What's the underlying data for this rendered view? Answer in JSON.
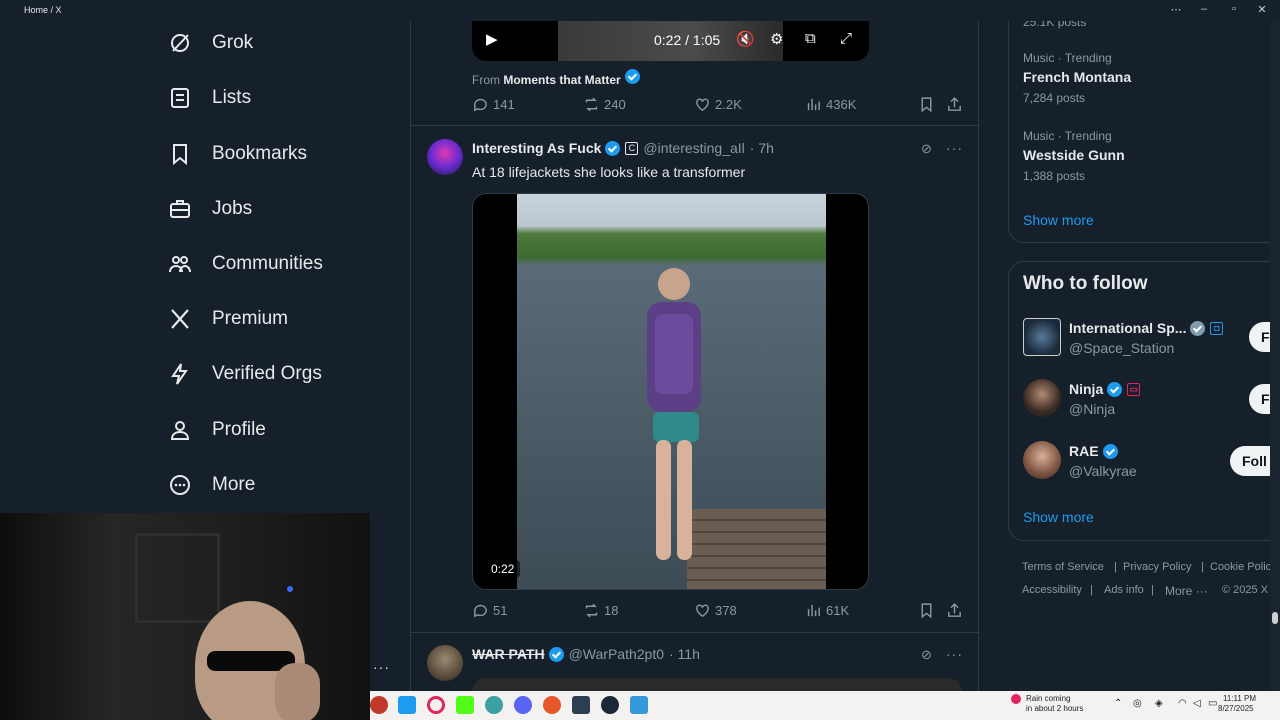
{
  "window": {
    "title": "Home / X"
  },
  "nav": {
    "items": [
      {
        "label": "Grok",
        "icon": "grok-icon"
      },
      {
        "label": "Lists",
        "icon": "lists-icon"
      },
      {
        "label": "Bookmarks",
        "icon": "bookmark-icon"
      },
      {
        "label": "Jobs",
        "icon": "briefcase-icon"
      },
      {
        "label": "Communities",
        "icon": "people-icon"
      },
      {
        "label": "Premium",
        "icon": "x-logo-icon"
      },
      {
        "label": "Verified Orgs",
        "icon": "lightning-icon"
      },
      {
        "label": "Profile",
        "icon": "person-icon"
      },
      {
        "label": "More",
        "icon": "more-circle-icon"
      }
    ]
  },
  "post1": {
    "video_time": "0:22 / 1:05",
    "from_prefix": "From",
    "from_source": "Moments that Matter",
    "replies": "141",
    "reposts": "240",
    "likes": "2.2K",
    "views": "436K"
  },
  "post2": {
    "name": "Interesting As Fuck",
    "handle": "@interesting_aIl",
    "time": "· 7h",
    "text": "At 18 lifejackets she looks like a transformer",
    "media_time": "0:22",
    "replies": "51",
    "reposts": "18",
    "likes": "378",
    "views": "61K"
  },
  "post3": {
    "name": "WAR PATH",
    "handle": "@WarPath2pt0",
    "time": "· 11h"
  },
  "trends": {
    "top_count": "25.1K posts",
    "items": [
      {
        "meta": "Music · Trending",
        "name": "French Montana",
        "posts": "7,284 posts"
      },
      {
        "meta": "Music · Trending",
        "name": "Westside Gunn",
        "posts": "1,388 posts"
      }
    ],
    "show_more": "Show more"
  },
  "who_to_follow": {
    "title": "Who to follow",
    "accounts": [
      {
        "name": "International Sp...",
        "handle": "@Space_Station",
        "follow": "F"
      },
      {
        "name": "Ninja",
        "handle": "@Ninja",
        "follow": "F"
      },
      {
        "name": "RAE",
        "handle": "@Valkyrae",
        "follow": "Foll"
      }
    ],
    "show_more": "Show more"
  },
  "footer": {
    "links": [
      "Terms of Service",
      "|",
      "Privacy Policy",
      "|",
      "Cookie Polic",
      "Accessibility",
      "|",
      "Ads info",
      "|",
      "More ···",
      "© 2025 X"
    ]
  },
  "taskbar": {
    "weather_line1": "Rain coming",
    "weather_line2": "in about 2 hours",
    "time": "11:11 PM",
    "date": "8/27/2025"
  },
  "colors": {
    "background": "#15202b",
    "accent": "#1d9bf0",
    "border": "#2f3c48",
    "muted": "#8b98a5"
  }
}
